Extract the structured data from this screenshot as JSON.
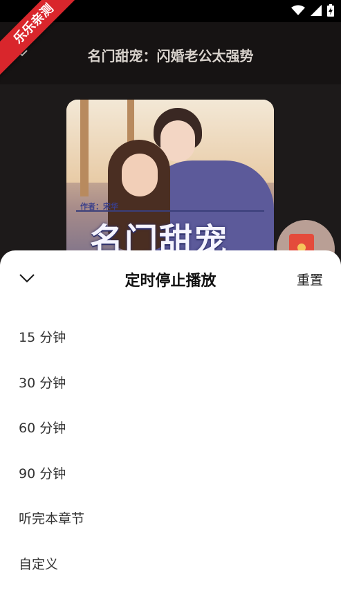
{
  "badge": {
    "text": "乐乐亲测"
  },
  "player": {
    "book_title": "名门甜宠：闪婚老公太强势",
    "cover_title": "名门甜宠",
    "cover_author": "作者：宋华"
  },
  "timer_sheet": {
    "title": "定时停止播放",
    "reset_label": "重置",
    "options": [
      {
        "label": "15 分钟"
      },
      {
        "label": "30 分钟"
      },
      {
        "label": "60 分钟"
      },
      {
        "label": "90 分钟"
      },
      {
        "label": "听完本章节"
      },
      {
        "label": "自定义"
      }
    ]
  },
  "icons": {
    "status": [
      "wifi-icon",
      "signal-icon",
      "battery-charging-icon"
    ],
    "header": "chevron-down-icon",
    "sheet": "chevron-down-icon",
    "floating": "red-packet-icon"
  },
  "colors": {
    "badge": "#d9262c",
    "sheet_bg": "#ffffff",
    "background": "#1d1a1a"
  }
}
